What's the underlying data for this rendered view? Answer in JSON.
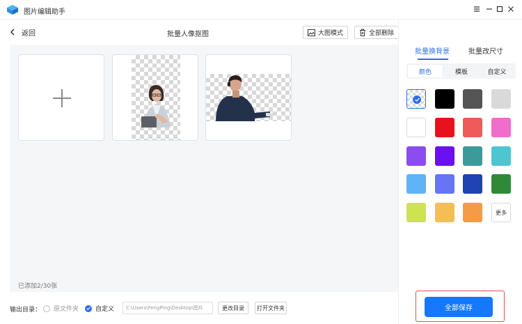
{
  "app": {
    "title": "图片编辑助手",
    "logo_icon": "app-logo-icon"
  },
  "window_controls": {
    "pin": "☰",
    "minimize": "−",
    "maximize": "☐",
    "close": "✕"
  },
  "toolbar": {
    "back_label": "返回",
    "page_title": "批量人像抠图",
    "large_view_label": "大图模式",
    "delete_all_label": "全部删除"
  },
  "canvas": {
    "add_icon": "plus-icon",
    "images": [
      {
        "name": "woman-with-glasses-at-laptop",
        "background": "transparent-checkerboard"
      },
      {
        "name": "man-in-hoodie-at-desk",
        "background": "transparent-checkerboard"
      }
    ],
    "added_count": "已添加2/30张"
  },
  "bottom": {
    "output_label": "输出目录：",
    "option_original": "原文件夹",
    "option_custom": "自定义",
    "selected_option": "custom",
    "path_value": "C:\\Users\\FengPing\\Desktop\\图片",
    "change_dir_label": "更改目录",
    "open_folder_label": "打开文件夹"
  },
  "right_panel": {
    "tabs": [
      {
        "label": "批量换背景",
        "active": true
      },
      {
        "label": "批量改尺寸",
        "active": false
      }
    ],
    "segments": [
      {
        "label": "颜色",
        "active": true
      },
      {
        "label": "模板",
        "active": false
      },
      {
        "label": "自定义",
        "active": false
      }
    ],
    "swatches": [
      {
        "color": "transparent",
        "selected": true
      },
      {
        "color": "#000000"
      },
      {
        "color": "#555555"
      },
      {
        "color": "#d9d9d9"
      },
      {
        "color": "#ffffff"
      },
      {
        "color": "#e8121e"
      },
      {
        "color": "#ef5a5a"
      },
      {
        "color": "#ef6dcd"
      },
      {
        "color": "#8b4df0"
      },
      {
        "color": "#6b10f2"
      },
      {
        "color": "#3e9a9a"
      },
      {
        "color": "#4fc6cf"
      },
      {
        "color": "#5fb3f7"
      },
      {
        "color": "#6873f5"
      },
      {
        "color": "#1f43b3"
      },
      {
        "color": "#2f8a37"
      },
      {
        "color": "#cde352"
      },
      {
        "color": "#f4be54"
      },
      {
        "color": "#f49b48"
      }
    ],
    "more_label": "更多",
    "save_all_label": "全部保存"
  },
  "colors": {
    "accent": "#1677ff",
    "highlight_frame": "#d9534f"
  }
}
